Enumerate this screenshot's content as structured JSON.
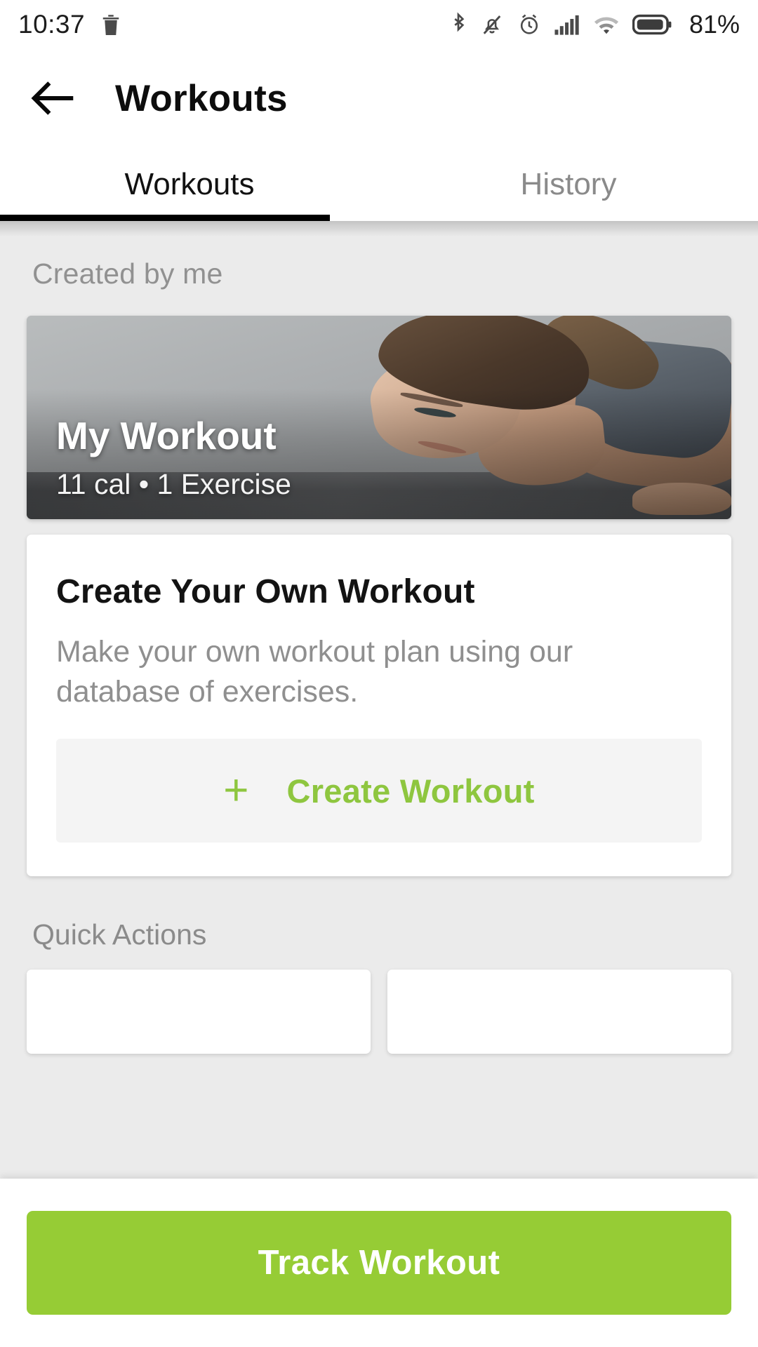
{
  "status_bar": {
    "time": "10:37",
    "battery_percent": "81%",
    "icons": [
      "trash-icon",
      "bluetooth-icon",
      "notification-muted-icon",
      "alarm-clock-icon",
      "cellular-signal-icon",
      "wifi-icon",
      "battery-icon"
    ]
  },
  "app_bar": {
    "back_icon": "arrow-left-icon",
    "title": "Workouts"
  },
  "tabs": {
    "items": [
      {
        "label": "Workouts",
        "active": true
      },
      {
        "label": "History",
        "active": false
      }
    ]
  },
  "content": {
    "created_section_label": "Created by me",
    "workout_card": {
      "title": "My Workout",
      "subtitle": "11 cal • 1 Exercise",
      "calories": "11 cal",
      "exercises": "1 Exercise"
    },
    "create_card": {
      "title": "Create Your Own Workout",
      "description": "Make your own workout plan using our database of exercises.",
      "button_icon": "plus-icon",
      "button_label": "Create Workout"
    },
    "quick_actions_label": "Quick Actions"
  },
  "bottom_bar": {
    "track_button_label": "Track Workout"
  },
  "colors": {
    "accent_green": "#96cc35",
    "create_link_green": "#8ec63f",
    "page_background": "#ebebeb",
    "surface": "#ffffff",
    "muted_text": "#8f8f8f",
    "primary_text": "#111111"
  }
}
